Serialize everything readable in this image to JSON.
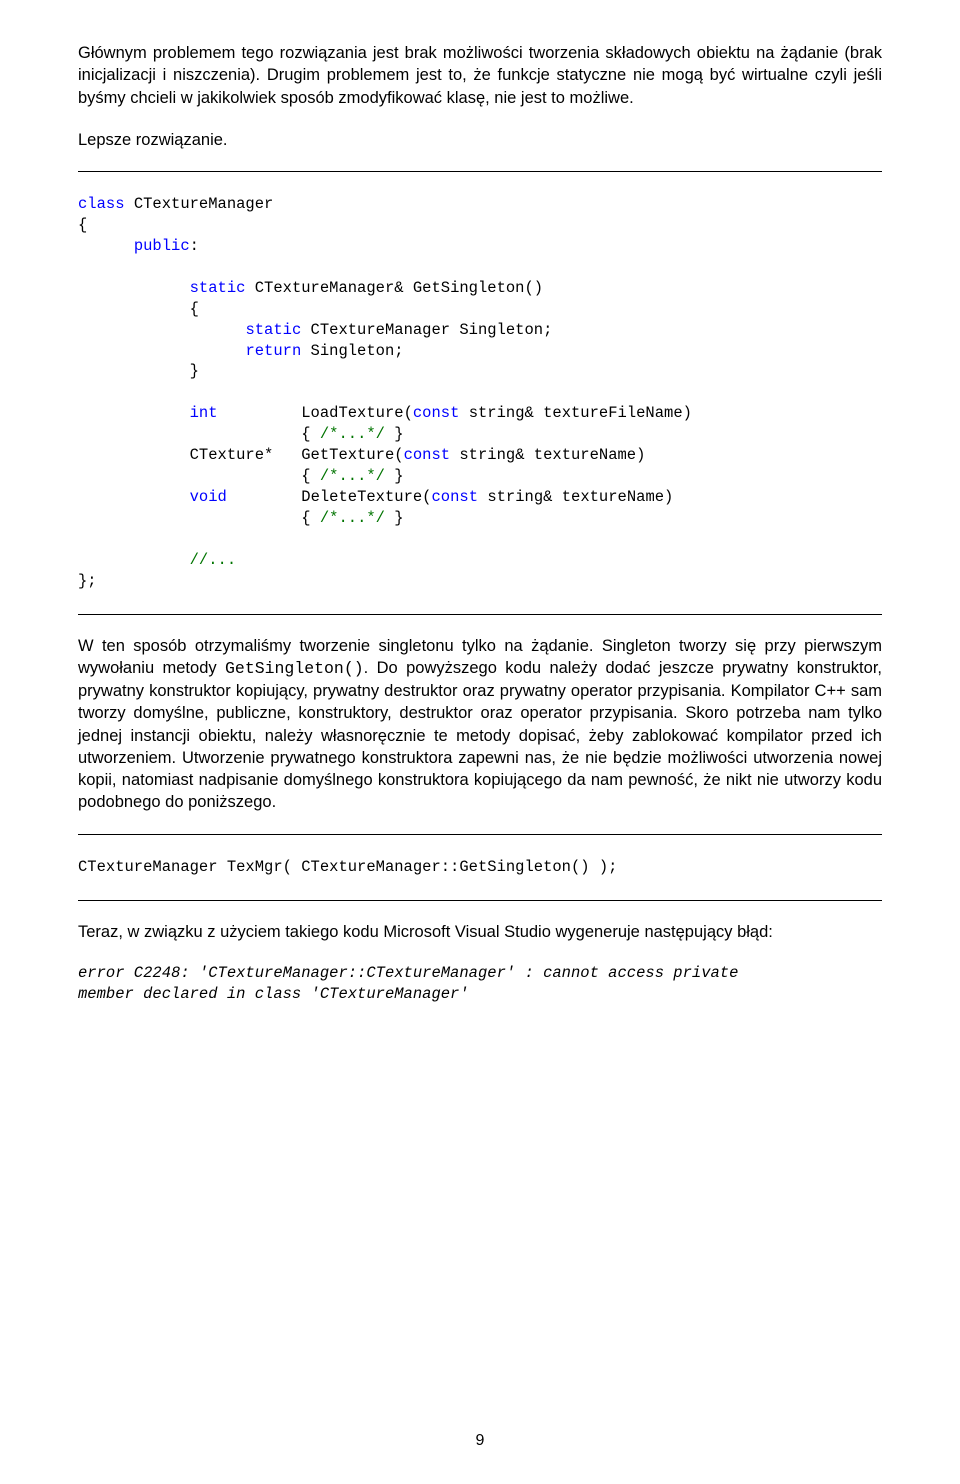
{
  "para1": "Głównym problemem tego rozwiązania jest brak możliwości tworzenia składowych obiektu na żądanie (brak inicjalizacji i niszczenia). Drugim problemem jest to, że funkcje statyczne nie mogą być wirtualne czyli jeśli byśmy chcieli w jakikolwiek sposób zmodyfikować klasę, nie jest to możliwe.",
  "para2": "Lepsze rozwiązanie.",
  "code1": {
    "l1a": "class",
    "l1b": " CTextureManager",
    "l2": "{",
    "l3a": "public",
    "l3b": ":",
    "l5a": "static",
    "l5b": " CTextureManager& GetSingleton()",
    "l6": "{",
    "l7a": "static",
    "l7b": " CTextureManager Singleton;",
    "l8a": "return",
    "l8b": " Singleton;",
    "l9": "}",
    "l11a": "int",
    "l11b": "LoadTexture(",
    "l11c": "const",
    "l11d": " string& textureFileName)",
    "l12a": "{ ",
    "l12b": "/*...*/",
    "l12c": " }",
    "l13a": "CTexture*   GetTexture(",
    "l13b": "const",
    "l13c": " string& textureName)",
    "l14a": "{ ",
    "l14b": "/*...*/",
    "l14c": " }",
    "l15a": "void",
    "l15b": "DeleteTexture(",
    "l15c": "const",
    "l15d": " string& textureName)",
    "l16a": "{ ",
    "l16b": "/*...*/",
    "l16c": " }",
    "l18": "//...",
    "l19": "};"
  },
  "para3a": "W ten sposób otrzymaliśmy tworzenie singletonu tylko na żądanie. Singleton tworzy się przy pierwszym wywołaniu metody ",
  "para3code": "GetSingleton()",
  "para3b": ". Do powyższego kodu należy dodać jeszcze prywatny konstruktor, prywatny konstruktor kopiujący, prywatny destruktor oraz prywatny operator przypisania. Kompilator C++ sam tworzy domyślne, publiczne, konstruktory, destruktor oraz operator przypisania. Skoro potrzeba nam tylko jednej instancji obiektu, należy własnoręcznie te metody dopisać, żeby zablokować kompilator przed ich utworzeniem. Utworzenie prywatnego konstruktora zapewni nas, że nie będzie możliwości utworzenia nowej kopii, natomiast nadpisanie domyślnego konstruktora kopiującego da nam pewność, że nikt nie utworzy kodu podobnego do poniższego.",
  "code2": "CTextureManager TexMgr( CTextureManager::GetSingleton() );",
  "para4": "Teraz, w związku z użyciem takiego kodu Microsoft Visual Studio wygeneruje następujący błąd:",
  "code3a": "error C2248: 'CTextureManager::CTextureManager' : cannot access private",
  "code3b": "member declared in class 'CTextureManager'",
  "pagenum": "9"
}
